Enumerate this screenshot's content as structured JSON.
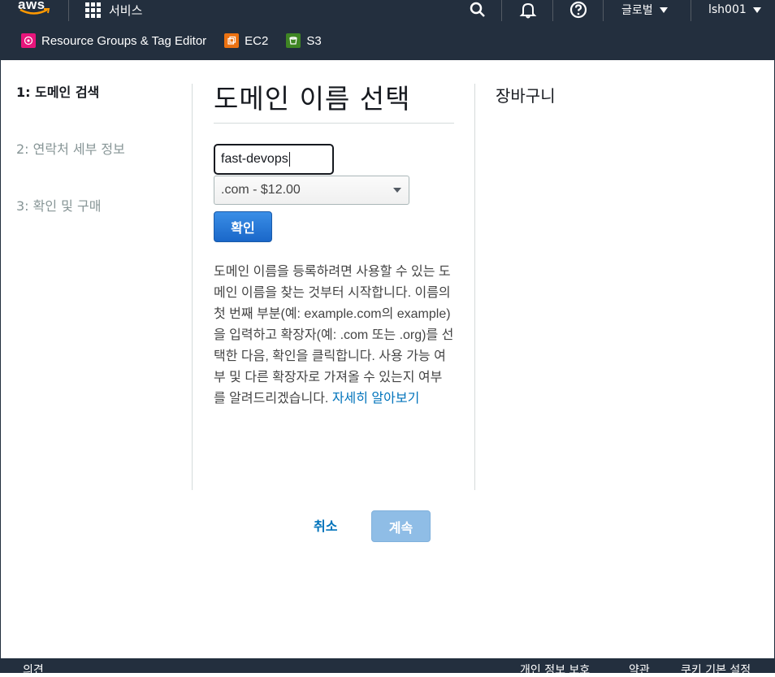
{
  "topbar": {
    "logo_text": "aws",
    "services_label": "서비스",
    "region_label": "글로벌",
    "account_label": "lsh001"
  },
  "favorites": [
    {
      "label": "Resource Groups & Tag Editor",
      "icon": "resource-groups-icon",
      "color": "#e7157b"
    },
    {
      "label": "EC2",
      "icon": "ec2-icon",
      "color": "#ec7211"
    },
    {
      "label": "S3",
      "icon": "s3-icon",
      "color": "#3f8624"
    }
  ],
  "steps": [
    {
      "label": "1: 도메인 검색",
      "active": true
    },
    {
      "label": "2: 연락처 세부 정보",
      "active": false
    },
    {
      "label": "3: 확인 및 구매",
      "active": false
    }
  ],
  "main": {
    "title": "도메인 이름 선택",
    "domain_value": "fast-devops",
    "tld_selected": ".com - $12.00",
    "confirm_label": "확인",
    "description": "도메인 이름을 등록하려면 사용할 수 있는 도메인 이름을 찾는 것부터 시작합니다. 이름의 첫 번째 부분(예: example.com의 example)을 입력하고 확장자(예: .com 또는 .org)를 선택한 다음, 확인을 클릭합니다. 사용 가능 여부 및 다른 확장자로 가져올 수 있는지 여부를 알려드리겠습니다.",
    "learn_more": "자세히 알아보기"
  },
  "cart": {
    "title": "장바구니"
  },
  "actions": {
    "cancel_label": "취소",
    "continue_label": "계속"
  },
  "footer": {
    "feedback": "의견",
    "privacy": "개인 정보 보호",
    "terms": "약관",
    "cookies": "쿠키 기본 설정"
  },
  "colors": {
    "header_bg": "#232f3e",
    "link": "#0073bb",
    "primary_button": "#1a67c9",
    "disabled_button": "#8fbde6"
  }
}
